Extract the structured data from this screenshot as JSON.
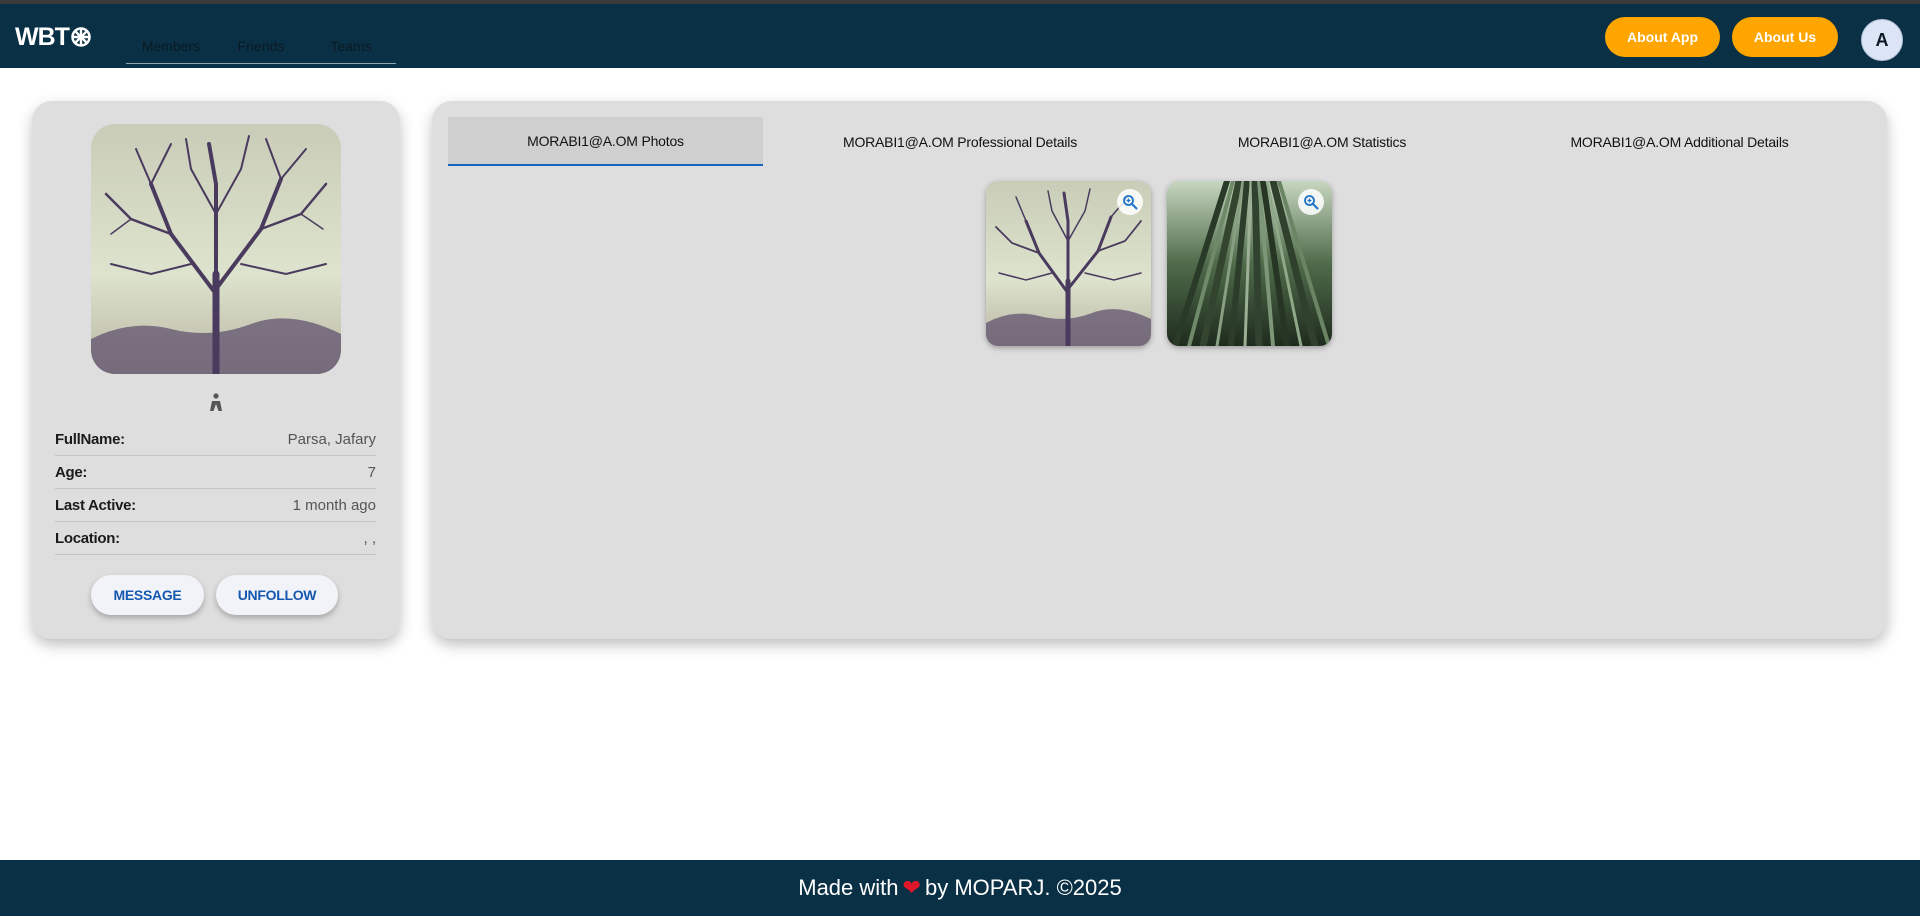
{
  "app": {
    "logo_text": "WBT",
    "logo_icon": "asterisk-wheel-icon"
  },
  "nav": {
    "tabs": [
      {
        "label": "Members"
      },
      {
        "label": "Friends"
      },
      {
        "label": "Teams"
      }
    ],
    "about_app": "About App",
    "about_us": "About Us",
    "avatar_letter": "A"
  },
  "profile": {
    "gender_icon": "person-icon",
    "rows": [
      {
        "label": "FullName:",
        "value": "Parsa, Jafary"
      },
      {
        "label": "Age:",
        "value": "7"
      },
      {
        "label": "Last Active:",
        "value": "1 month ago"
      },
      {
        "label": "Location:",
        "value": ", ,"
      }
    ],
    "message_label": "MESSAGE",
    "unfollow_label": "UNFOLLOW"
  },
  "main": {
    "tabs": [
      {
        "label": "MORABI1@A.OM Photos",
        "active": true
      },
      {
        "label": "MORABI1@A.OM Professional Details",
        "active": false
      },
      {
        "label": "MORABI1@A.OM Statistics",
        "active": false
      },
      {
        "label": "MORABI1@A.OM Additional Details",
        "active": false
      }
    ],
    "photos": [
      {
        "subject": "bare-tree-photo",
        "icon": "zoom-in-icon"
      },
      {
        "subject": "bamboo-forest-photo",
        "icon": "zoom-in-icon"
      }
    ]
  },
  "footer": {
    "before": "Made with",
    "heart": "❤",
    "after": "by MOPARJ. ©2025"
  },
  "colors": {
    "navbar": "#0a3045",
    "accent": "#ffa500",
    "card": "#dedede",
    "link": "#1558b0",
    "tab_underline": "#1565c0"
  }
}
